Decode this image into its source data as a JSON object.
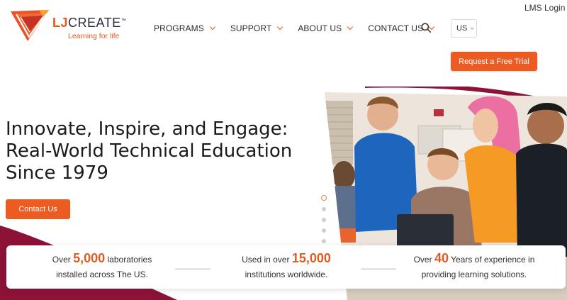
{
  "header": {
    "lms_login": "LMS Login",
    "logo_brand_lj": "LJ",
    "logo_brand_create": "CREATE",
    "logo_tm": "™",
    "logo_tagline": "Learning for life",
    "nav": [
      {
        "label": "PROGRAMS"
      },
      {
        "label": "SUPPORT"
      },
      {
        "label": "ABOUT US"
      },
      {
        "label": "CONTACT US"
      }
    ],
    "search_icon": "search-icon",
    "language": "US",
    "trial_button": "Request a Free Trial"
  },
  "hero": {
    "title_lines": [
      "Innovate, Inspire, and Engage:",
      "Real-World Technical Education",
      "Since 1979"
    ],
    "contact_button": "Contact Us",
    "image_alt": "Students smiling around a classroom workstation",
    "slider_count": 5,
    "slider_active": 1
  },
  "stats": [
    {
      "prefix": "Over ",
      "number": "5,000",
      "suffix": " laboratories",
      "line2": "installed across The US."
    },
    {
      "prefix": "Used in over ",
      "number": "15,000",
      "suffix": "",
      "line2": "institutions worldwide."
    },
    {
      "prefix": "Over ",
      "number": "40",
      "suffix": " Years of experience in",
      "line2": "providing learning solutions."
    }
  ],
  "colors": {
    "accent": "#ec5b22",
    "maroon": "#8c1337"
  }
}
